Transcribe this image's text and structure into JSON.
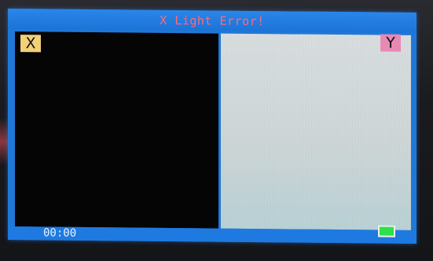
{
  "window": {
    "title": "X Light Error!"
  },
  "panels": {
    "left_label": "X",
    "right_label": "Y"
  },
  "status": {
    "time": "00:00"
  },
  "colors": {
    "frame": "#1f78d8",
    "title_text": "#ff6a7a",
    "left_panel": "#050506",
    "right_panel": "#d9dfe0",
    "x_badge": "#f1d077",
    "y_badge": "#e889b4",
    "battery": "#2ee04a"
  },
  "icons": {
    "battery": "battery-icon"
  }
}
